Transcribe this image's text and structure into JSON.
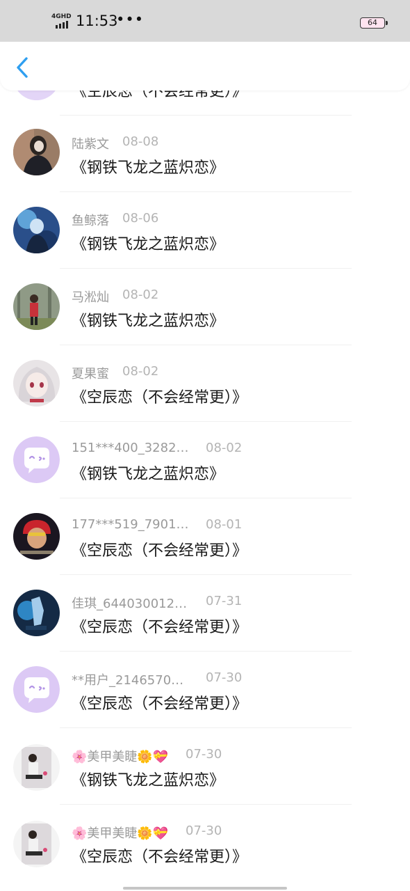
{
  "status_bar": {
    "network": "4GHD",
    "time": "11:53",
    "dots": "•••",
    "battery": "64"
  },
  "header": {
    "back_icon": "chevron-left-icon",
    "accent_color": "#2f9ff0"
  },
  "partial_row": {
    "title": "《空辰恋（不会经常更）》"
  },
  "rows": [
    {
      "name": "陆紫文",
      "date": "08-08",
      "title": "《钢铁飞龙之蓝炽恋》",
      "avatar": "photo-avatar"
    },
    {
      "name": "鱼鲸落",
      "date": "08-06",
      "title": "《钢铁飞龙之蓝炽恋》",
      "avatar": "anime-avatar"
    },
    {
      "name": "马淞灿",
      "date": "08-02",
      "title": "《钢铁飞龙之蓝炽恋》",
      "avatar": "photo-avatar"
    },
    {
      "name": "夏果蜜",
      "date": "08-02",
      "title": "《空辰恋（不会经常更）》",
      "avatar": "anime-avatar"
    },
    {
      "name": "151***400_3282…",
      "date": "08-02",
      "title": "《钢铁飞龙之蓝炽恋》",
      "avatar": "default-chat-avatar"
    },
    {
      "name": "177***519_7901…",
      "date": "08-01",
      "title": "《空辰恋（不会经常更）》",
      "avatar": "anime-avatar"
    },
    {
      "name": "佳琪_644030012…",
      "date": "07-31",
      "title": "《空辰恋（不会经常更）》",
      "avatar": "anime-avatar"
    },
    {
      "name": "**用户_2146570…",
      "date": "07-30",
      "title": "《空辰恋（不会经常更）》",
      "avatar": "default-chat-avatar"
    },
    {
      "name": "🌸美甲美睫🌼💝",
      "date": "07-30",
      "title": "《钢铁飞龙之蓝炽恋》",
      "avatar": "photo-avatar"
    },
    {
      "name": "🌸美甲美睫🌼💝",
      "date": "07-30",
      "title": "《空辰恋（不会经常更）》",
      "avatar": "photo-avatar"
    }
  ]
}
